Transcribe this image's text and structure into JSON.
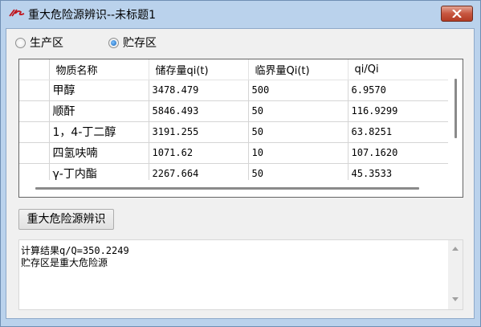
{
  "window": {
    "title": "重大危险源辨识--未标题1",
    "icon": "app-logo-icon",
    "title_bar_color": "#bad2ec",
    "close_button_color": "#c7563f"
  },
  "radios": [
    {
      "label": "生产区",
      "checked": false
    },
    {
      "label": "贮存区",
      "checked": true
    }
  ],
  "grid": {
    "columns": [
      "",
      "物质名称",
      "储存量qi(t)",
      "临界量Qi(t)",
      "qi/Qi"
    ],
    "rows": [
      {
        "name": "甲醇",
        "storage": "3478.479",
        "critical": "500",
        "ratio": "6.9570"
      },
      {
        "name": "顺酐",
        "storage": "5846.493",
        "critical": "50",
        "ratio": "116.9299"
      },
      {
        "name": "1，4-丁二醇",
        "storage": "3191.255",
        "critical": "50",
        "ratio": "63.8251"
      },
      {
        "name": "四氢呋喃",
        "storage": "1071.62",
        "critical": "10",
        "ratio": "107.1620"
      },
      {
        "name": "γ-丁内酯",
        "storage": "2267.664",
        "critical": "50",
        "ratio": "45.3533"
      }
    ]
  },
  "action_button": {
    "label": "重大危险源辨识"
  },
  "result": {
    "lines": [
      "计算结果q/Q=350.2249",
      "贮存区是重大危险源"
    ]
  }
}
